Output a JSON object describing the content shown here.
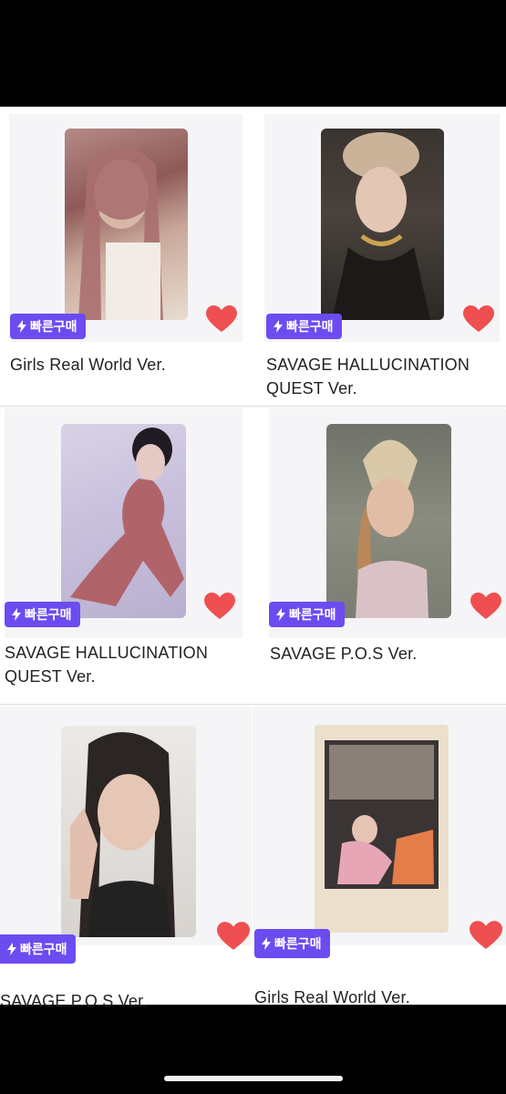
{
  "listing": {
    "items": [
      {
        "title": "Girls Real World Ver.",
        "badge": "빠른구매",
        "liked": true
      },
      {
        "title": "SAVAGE HALLUCINATION QUEST Ver.",
        "badge": "빠른구매",
        "liked": true
      },
      {
        "title": "SAVAGE HALLUCINATION QUEST Ver.",
        "badge": "빠른구매",
        "liked": true
      },
      {
        "title": "SAVAGE P.O.S Ver.",
        "badge": "빠른구매",
        "liked": true
      },
      {
        "title": "SAVAGE P.O.S Ver.",
        "badge": "빠른구매",
        "liked": true
      },
      {
        "title": "Girls Real World Ver.",
        "badge": "빠른구매",
        "liked": true
      }
    ]
  },
  "colors": {
    "badge_bg": "#6c4cf1",
    "heart": "#ef4f50",
    "title_text": "#222222"
  },
  "icons": {
    "badge_icon": "lightning-bolt-icon",
    "like_icon": "heart-icon"
  }
}
